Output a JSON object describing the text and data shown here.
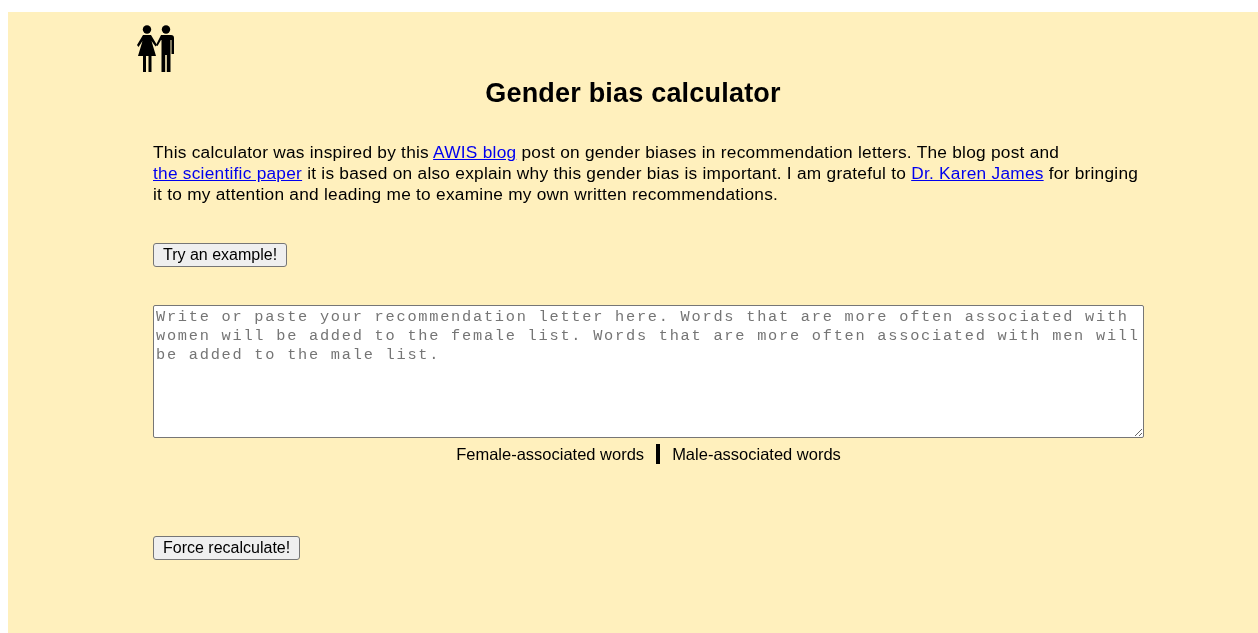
{
  "title": "Gender bias calculator",
  "intro": [
    {
      "kind": "text",
      "text": "This calculator was inspired by this "
    },
    {
      "kind": "link",
      "text": "AWIS blog"
    },
    {
      "kind": "text",
      "text": " post on gender biases in recommendation letters. The blog post and "
    },
    {
      "kind": "link",
      "text": "the scientific paper"
    },
    {
      "kind": "text",
      "text": " it is based on also explain why this gender bias is important. I am grateful to "
    },
    {
      "kind": "link",
      "text": "Dr. Karen James"
    },
    {
      "kind": "text",
      "text": " for bringing it to my attention and leading me to examine my own written recommendations."
    }
  ],
  "example_button": "Try an example!",
  "letter_field": {
    "placeholder": "Write or paste your recommendation letter here. Words that are more often associated with women will be added to the female list. Words that are more often associated with men will be added to the male list."
  },
  "lists": [
    {
      "label": "Female-associated words"
    },
    {
      "label": "Male-associated words"
    }
  ],
  "recalculate_button": "Force recalculate!"
}
